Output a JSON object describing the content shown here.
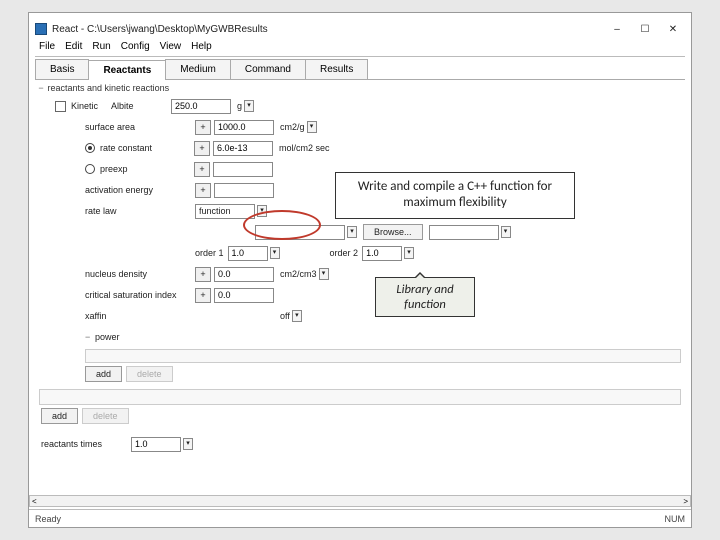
{
  "window": {
    "title": "React - C:\\Users\\jwang\\Desktop\\MyGWBResults",
    "min": "–",
    "max": "☐",
    "close": "✕"
  },
  "menu": [
    "File",
    "Edit",
    "Run",
    "Config",
    "View",
    "Help"
  ],
  "tabs": [
    "Basis",
    "Reactants",
    "Medium",
    "Command",
    "Results"
  ],
  "active_tab": "Reactants",
  "section_label": "reactants and kinetic reactions",
  "rows": {
    "kinetic": {
      "label": "Kinetic",
      "mineral": "Albite",
      "value": "250.0",
      "unit": "g"
    },
    "surface_area": {
      "label": "surface area",
      "value": "1000.0",
      "unit": "cm2/g"
    },
    "rate_constant": {
      "label": "rate constant",
      "value": "6.0e-13",
      "unit": "mol/cm2 sec"
    },
    "preexp": {
      "label": "preexp",
      "value": ""
    },
    "activation_energy": {
      "label": "activation energy",
      "value": ""
    },
    "rate_law": {
      "label": "rate law",
      "value": "function"
    },
    "browse": "Browse...",
    "order1": {
      "label": "order 1",
      "value": "1.0"
    },
    "order2": {
      "label": "order 2",
      "value": "1.0"
    },
    "nucleus_density": {
      "label": "nucleus density",
      "value": "0.0",
      "unit": "cm2/cm3"
    },
    "crit_sat": {
      "label": "critical saturation index",
      "value": "0.0"
    },
    "xaffin": {
      "label": "xaffin",
      "unit": "off"
    },
    "power": {
      "label": "power"
    }
  },
  "buttons": {
    "add": "add",
    "delete": "delete",
    "plus": "+"
  },
  "reactants_times": {
    "label": "reactants times",
    "value": "1.0"
  },
  "callouts": {
    "c1": "Write and compile a C++ function for maximum flexibility",
    "c2": "Library and function"
  },
  "status": {
    "ready": "Ready",
    "num": "NUM"
  }
}
